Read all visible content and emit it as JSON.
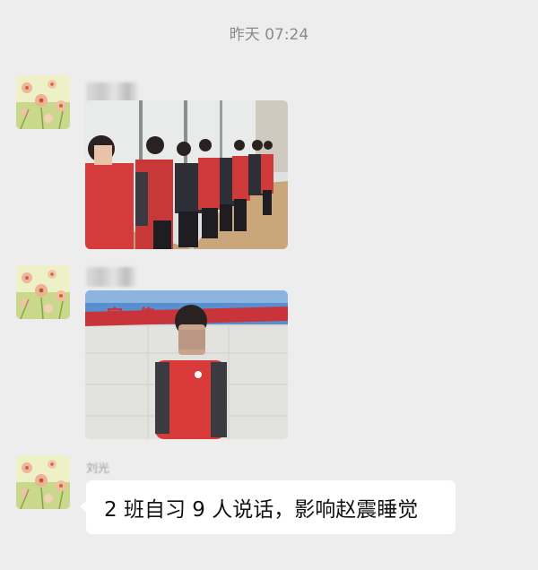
{
  "header": {
    "timestamp": "昨天 07:24"
  },
  "messages": [
    {
      "type": "image",
      "avatar_icon": "flower-avatar-icon",
      "image_subject": "students-lined-up-photo"
    },
    {
      "type": "image",
      "avatar_icon": "flower-avatar-icon",
      "image_subject": "student-against-wall-photo",
      "banner_text": "宣传"
    },
    {
      "type": "text",
      "avatar_icon": "flower-avatar-icon",
      "sender_partial": "刘光",
      "text": "2 班自习 9 人说话，影响赵震睡觉"
    }
  ],
  "colors": {
    "background": "#ededed",
    "bubble": "#ffffff",
    "uniform_red": "#d93a3a",
    "uniform_dark": "#2e2e33"
  }
}
